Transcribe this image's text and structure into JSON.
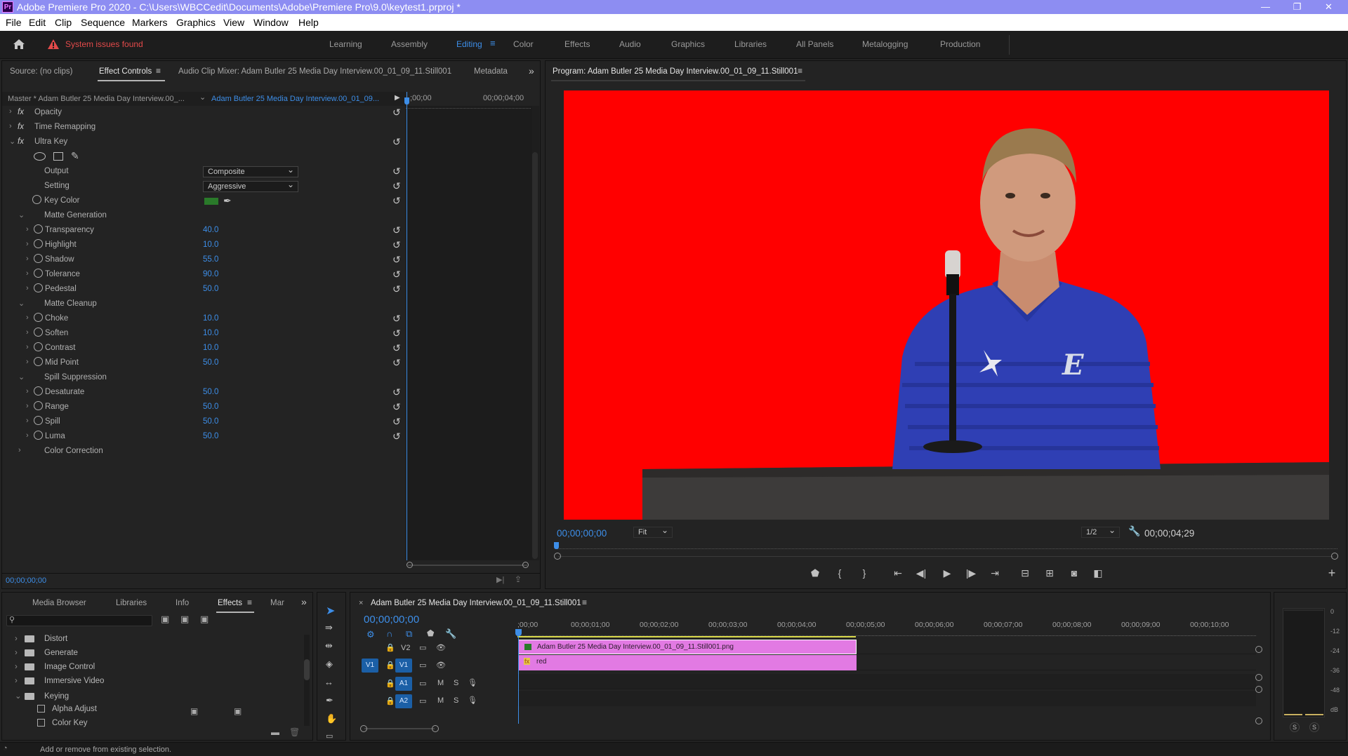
{
  "window": {
    "app_icon": "Pr",
    "title": "Adobe Premiere Pro 2020 - C:\\Users\\WBCCedit\\Documents\\Adobe\\Premiere Pro\\9.0\\keytest1.prproj *",
    "minimize": "—",
    "restore": "❐",
    "close": "✕"
  },
  "menu": [
    "File",
    "Edit",
    "Clip",
    "Sequence",
    "Markers",
    "Graphics",
    "View",
    "Window",
    "Help"
  ],
  "workspace": {
    "warning": "System issues found",
    "tabs": [
      "Learning",
      "Assembly",
      "Editing",
      "Color",
      "Effects",
      "Audio",
      "Graphics",
      "Libraries",
      "All Panels",
      "Metalogging",
      "Production"
    ],
    "active": "Editing"
  },
  "source_panel": {
    "tabs": [
      "Source: (no clips)",
      "Effect Controls",
      "Audio Clip Mixer: Adam Butler 25 Media Day Interview.00_01_09_11.Still001",
      "Metadata"
    ],
    "master_label": "Master * Adam Butler 25 Media Day Interview.00_...",
    "clip_label": "Adam Butler 25 Media Day Interview.00_01_09...",
    "time_start": ";00;00",
    "time_end": "00;00;04;00",
    "timecode": "00;00;00;00",
    "effects": {
      "opacity": "Opacity",
      "time_remap": "Time Remapping",
      "ultra_key": "Ultra Key",
      "output_label": "Output",
      "output_value": "Composite",
      "setting_label": "Setting",
      "setting_value": "Aggressive",
      "key_color_label": "Key Color",
      "key_color": "#2a7a2a",
      "matte_generation": "Matte Generation",
      "matte_cleanup": "Matte Cleanup",
      "spill_suppression": "Spill Suppression",
      "color_correction": "Color Correction",
      "gen_params": [
        {
          "name": "Transparency",
          "value": "40.0"
        },
        {
          "name": "Highlight",
          "value": "10.0"
        },
        {
          "name": "Shadow",
          "value": "55.0"
        },
        {
          "name": "Tolerance",
          "value": "90.0"
        },
        {
          "name": "Pedestal",
          "value": "50.0"
        }
      ],
      "cleanup_params": [
        {
          "name": "Choke",
          "value": "10.0"
        },
        {
          "name": "Soften",
          "value": "10.0"
        },
        {
          "name": "Contrast",
          "value": "10.0"
        },
        {
          "name": "Mid Point",
          "value": "50.0"
        }
      ],
      "spill_params": [
        {
          "name": "Desaturate",
          "value": "50.0"
        },
        {
          "name": "Range",
          "value": "50.0"
        },
        {
          "name": "Spill",
          "value": "50.0"
        },
        {
          "name": "Luma",
          "value": "50.0"
        }
      ]
    }
  },
  "program": {
    "title": "Program: Adam Butler 25 Media Day Interview.00_01_09_11.Still001",
    "timecode": "00;00;00;00",
    "fit": "Fit",
    "resolution": "1/2",
    "duration": "00;00;04;29",
    "bg_color": "#ff0000"
  },
  "effects_panel": {
    "tabs": [
      "Media Browser",
      "Libraries",
      "Info",
      "Effects",
      "Mar"
    ],
    "active": "Effects",
    "folders": [
      {
        "name": "Distort",
        "open": false
      },
      {
        "name": "Generate",
        "open": false
      },
      {
        "name": "Image Control",
        "open": false
      },
      {
        "name": "Immersive Video",
        "open": false
      },
      {
        "name": "Keying",
        "open": true
      }
    ],
    "items": [
      "Alpha Adjust",
      "Color Key"
    ]
  },
  "timeline": {
    "title": "Adam Butler 25 Media Day Interview.00_01_09_11.Still001",
    "timecode": "00;00;00;00",
    "ruler": [
      ";00;00",
      "00;00;01;00",
      "00;00;02;00",
      "00;00;03;00",
      "00;00;04;00",
      "00;00;05;00",
      "00;00;06;00",
      "00;00;07;00",
      "00;00;08;00",
      "00;00;09;00",
      "00;00;10;00"
    ],
    "tracks": {
      "v2": "V2",
      "v1": "V1",
      "a1": "A1",
      "a2": "A2",
      "m": "M",
      "s": "S"
    },
    "clip_top": "Adam Butler 25 Media Day Interview.00_01_09_11.Still001.png",
    "clip_bottom_fx": "fx",
    "clip_bottom": "red",
    "clip_color": "#e27ae3"
  },
  "meter": {
    "labels": [
      "0",
      "-12",
      "-24",
      "-36",
      "-48",
      "dB"
    ],
    "solo": "S"
  },
  "status": {
    "text": "Add or remove from existing selection."
  }
}
